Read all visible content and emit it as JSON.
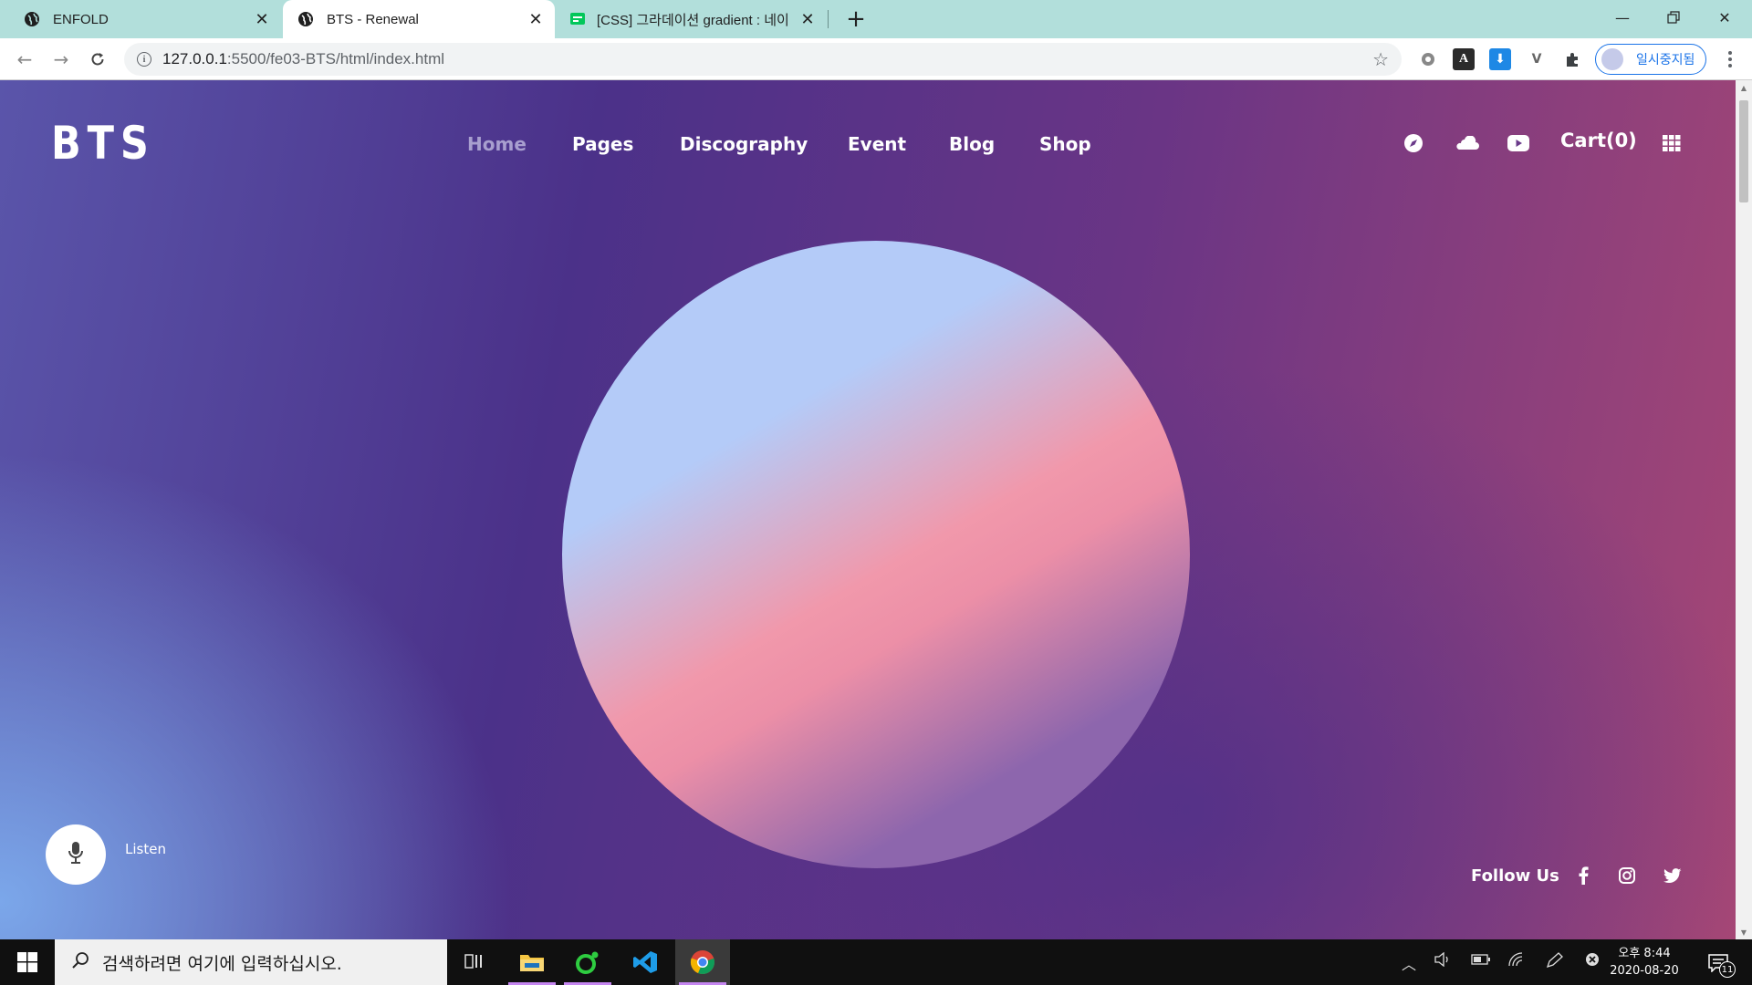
{
  "browser": {
    "tabs": [
      {
        "title": "ENFOLD",
        "active": false,
        "favicon": "globe-icon"
      },
      {
        "title": "BTS - Renewal",
        "active": true,
        "favicon": "globe-icon"
      },
      {
        "title": "[CSS] 그라데이션 gradient : 네이",
        "active": false,
        "favicon": "naver-blog-icon"
      }
    ],
    "address": {
      "host": "127.0.0.1",
      "rest": ":5500/fe03-BTS/html/index.html"
    },
    "profile_label": "일시중지됨"
  },
  "site": {
    "logo": "BTS",
    "nav": [
      "Home",
      "Pages",
      "Discography",
      "Event",
      "Blog",
      "Shop"
    ],
    "nav_current": "Home",
    "cart_label": "Cart(0)",
    "listen_label": "Listen",
    "follow_label": "Follow Us",
    "colors": {
      "orb_top": "#b4cbf8",
      "orb_mid": "#f198ab",
      "orb_bottom": "#8d66ad",
      "nav_active": "#a89fcf"
    }
  },
  "taskbar": {
    "search_placeholder": "검색하려면 여기에 입력하십시오.",
    "time": "오후 8:44",
    "date": "2020-08-20",
    "notification_count": "11"
  }
}
